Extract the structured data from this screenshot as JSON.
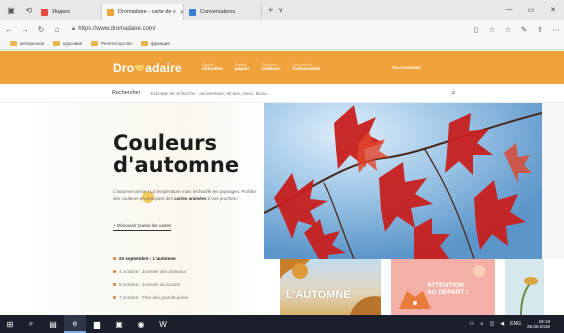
{
  "browser": {
    "tabs": [
      {
        "label": "Яндекс",
        "fav_color": "#e54c3c",
        "active": false
      },
      {
        "label": "Dromadaire - carte de v",
        "fav_color": "#f0a23c",
        "active": true
      },
      {
        "label": "Conversations",
        "fav_color": "#3a7bd5",
        "active": false
      }
    ],
    "new_tab": "+",
    "tab_list": "∨",
    "url": "https://www.dromadaire.com/",
    "bookmarks": [
      "интересное",
      "курсовая",
      "Репетиторство",
      "франция"
    ]
  },
  "site": {
    "logo": {
      "left": "Dro",
      "right": "adaire"
    },
    "nav": [
      {
        "small": "Cartes",
        "big": "virtuelles"
      },
      {
        "small": "Cartes",
        "big": "papier"
      },
      {
        "small": "Chèques",
        "big": "cadeaux"
      },
      {
        "small": "Les grands",
        "big": "événements"
      }
    ],
    "signin": "Se connecter",
    "search": {
      "label": "Rechercher",
      "placeholder": "Exemple de recherche : anniversaire, 30 ans, merci, bisou..."
    }
  },
  "hero": {
    "title_line1": "Couleurs",
    "title_line2": "d'automne",
    "text_part1": "L'automne arrive ! La température mais réchauffe les",
    "text_part2": "paysages. Profitez des couleurs en envoyant des",
    "text_bold": "cartes animées",
    "text_end": " à vos proches !",
    "discover_link": "+ Découvrir toutes les cartes",
    "events": [
      "23 septembre : L'automne",
      "4 octobre : Journée des animaux",
      "5 octobre : Journée du sourire",
      "7 octobre : Fête des grands-pères"
    ]
  },
  "cards": {
    "card1_text": "L'AUTOMNE",
    "card2_line1": "ATTENTION",
    "card2_line2": "AU DÉPART !"
  },
  "taskbar": {
    "tray_lang": "ENG",
    "time": "19:19",
    "date": "26.09.2018"
  }
}
